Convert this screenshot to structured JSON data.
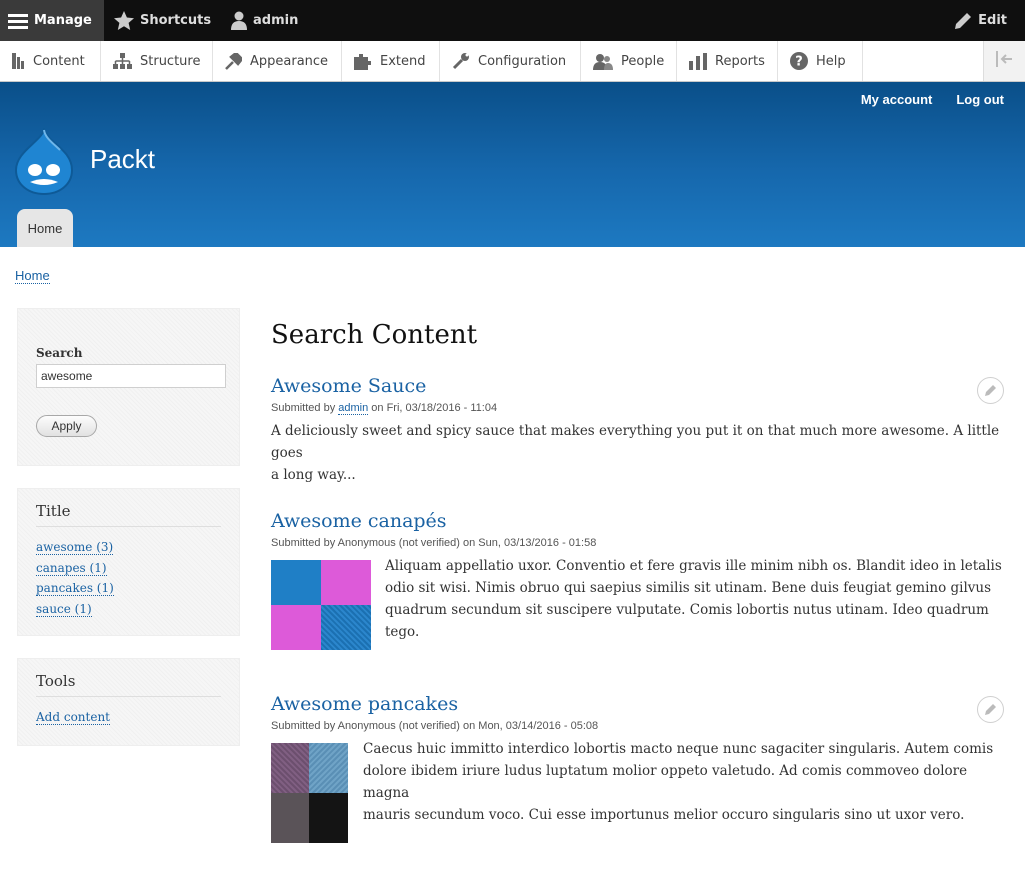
{
  "toolbar": {
    "manage": "Manage",
    "shortcuts": "Shortcuts",
    "user": "admin",
    "edit": "Edit"
  },
  "tray": {
    "items": [
      {
        "label": "Content",
        "icon": "content-icon"
      },
      {
        "label": "Structure",
        "icon": "structure-icon"
      },
      {
        "label": "Appearance",
        "icon": "appearance-icon"
      },
      {
        "label": "Extend",
        "icon": "extend-icon"
      },
      {
        "label": "Configuration",
        "icon": "configuration-icon"
      },
      {
        "label": "People",
        "icon": "people-icon"
      },
      {
        "label": "Reports",
        "icon": "reports-icon"
      },
      {
        "label": "Help",
        "icon": "help-icon"
      }
    ]
  },
  "header": {
    "my_account": "My account",
    "log_out": "Log out",
    "site_name": "Packt",
    "home_tab": "Home"
  },
  "breadcrumb": {
    "home": "Home"
  },
  "search_block": {
    "label": "Search",
    "value": "awesome",
    "apply": "Apply"
  },
  "title_block": {
    "heading": "Title",
    "facets": [
      "awesome (3)",
      "canapes (1)",
      "pancakes (1)",
      "sauce (1)"
    ]
  },
  "tools_block": {
    "heading": "Tools",
    "add_content": "Add content"
  },
  "main": {
    "title": "Search Content",
    "results": [
      {
        "title": "Awesome Sauce",
        "submitted_prefix": "Submitted by ",
        "author": "admin",
        "submitted_suffix": " on Fri, 03/18/2016 - 11:04",
        "teaser_lines": [
          "A deliciously sweet and spicy sauce that makes everything you put it on that much more awesome. A little goes",
          "a long way..."
        ]
      },
      {
        "title": "Awesome canapés",
        "submitted": "Submitted by Anonymous (not verified) on Sun, 03/13/2016 - 01:58",
        "teaser_lines": [
          "Aliquam appellatio uxor. Conventio et fere gravis ille minim nibh os. Blandit ideo in letalis",
          "odio sit wisi. Nimis obruo qui saepius similis sit utinam. Bene duis feugiat gemino gilvus",
          "quadrum secundum sit suscipere vulputate. Comis lobortis nutus utinam. Ideo quadrum tego."
        ]
      },
      {
        "title": "Awesome pancakes",
        "submitted": "Submitted by Anonymous (not verified) on Mon, 03/14/2016 - 05:08",
        "teaser_lines": [
          "Caecus huic immitto interdico lobortis macto neque nunc sagaciter singularis. Autem comis",
          "dolore ibidem iriure ludus luptatum molior oppeto valetudo. Ad comis commoveo dolore magna",
          "mauris secundum voco. Cui esse importunus melior occuro singularis sino ut uxor vero."
        ]
      }
    ]
  },
  "colors": {
    "header_top": "#0a4f89",
    "header_bottom": "#1d79c1",
    "link": "#1a62a3"
  }
}
